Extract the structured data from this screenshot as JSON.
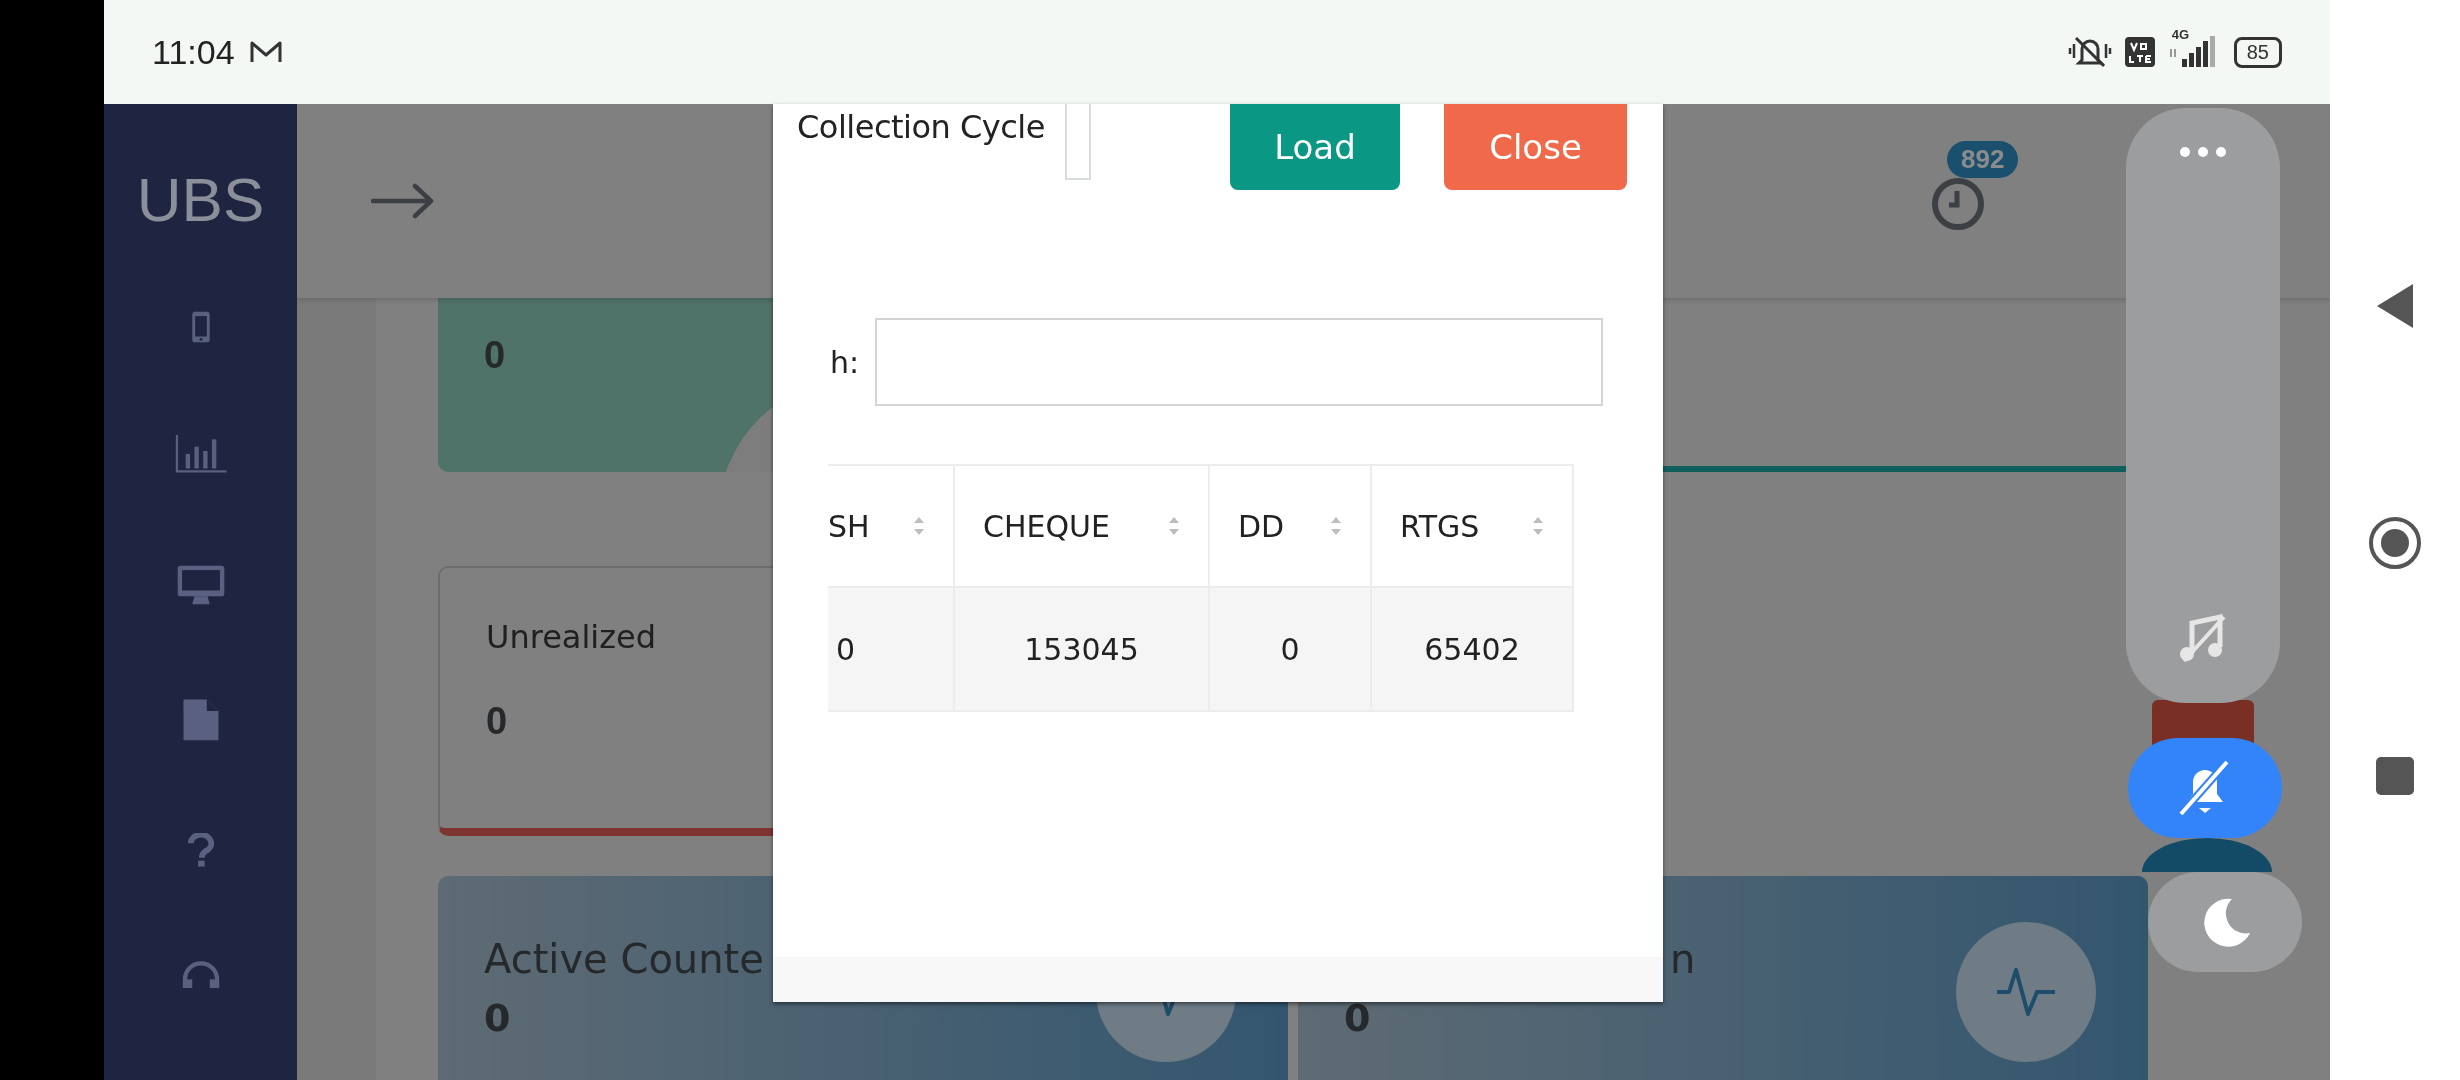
{
  "status_bar": {
    "time": "11:04",
    "network": "4G",
    "battery": "85"
  },
  "sidebar": {
    "logo": "UBS"
  },
  "header": {
    "notification_count": "892"
  },
  "card_rows": [
    [
      {
        "kind": "teal",
        "value": "0"
      },
      {
        "kind": "plain"
      }
    ],
    [
      {
        "kind": "outline",
        "title": "Unrealized",
        "value": "0"
      }
    ],
    [
      {
        "kind": "gradient",
        "title": "Active Counte",
        "value": "0"
      },
      {
        "kind": "gradient",
        "title": "n",
        "value": "0"
      }
    ]
  ],
  "modal": {
    "cycle_label": "Collection Cycle",
    "buttons": [
      {
        "label": "Load",
        "kind": "primary"
      },
      {
        "label": "Close",
        "kind": "danger"
      }
    ],
    "search_label": "h:",
    "table": {
      "columns": [
        "SH",
        "CHEQUE",
        "DD",
        "RTGS"
      ],
      "rows": [
        [
          "0",
          "153045",
          "0",
          "65402"
        ]
      ]
    }
  }
}
